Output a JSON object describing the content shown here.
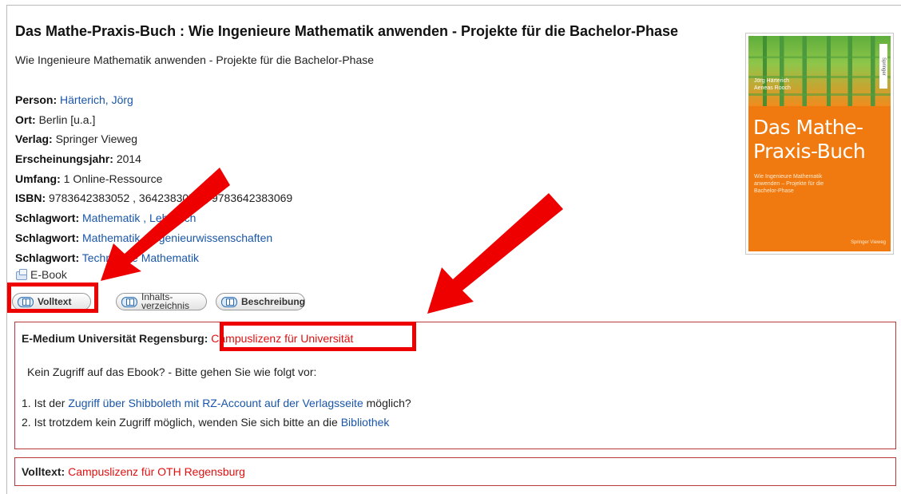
{
  "record": {
    "title": "Das Mathe-Praxis-Buch :  Wie Ingenieure Mathematik anwenden - Projekte für die Bachelor-Phase",
    "subtitle": "Wie Ingenieure Mathematik anwenden - Projekte für die Bachelor-Phase"
  },
  "meta": {
    "person_label": "Person:",
    "person_value": "Härterich, Jörg",
    "ort_label": "Ort:",
    "ort_value": "Berlin [u.a.]",
    "verlag_label": "Verlag:",
    "verlag_value": "Springer Vieweg",
    "jahr_label": "Erscheinungsjahr:",
    "jahr_value": "2014",
    "umfang_label": "Umfang:",
    "umfang_value": "1 Online-Ressource",
    "isbn_label": "ISBN:",
    "isbn_value": "9783642383052 , 364238305X , 9783642383069",
    "schlagwort_label": "Schlagwort:",
    "schlagwort_1": "Mathematik , Lehrbuch",
    "schlagwort_2": "Mathematik , Ingenieurwissenschaften",
    "schlagwort_3": "Technische Mathematik"
  },
  "media_type": "E-Book",
  "buttons": {
    "volltext": "Volltext",
    "inhalt_line1": "Inhalts-",
    "inhalt_line2": "verzeichnis",
    "beschreibung": "Beschreibung"
  },
  "access_panel": {
    "label": "E-Medium Universität Regensburg:",
    "license": "Campuslizenz für Universität",
    "notice": "Kein Zugriff auf das Ebook? - Bitte gehen Sie wie folgt vor:",
    "step1_prefix": "1. Ist der ",
    "step1_link": "Zugriff über Shibboleth mit RZ-Account auf der Verlagsseite",
    "step1_suffix": " möglich?",
    "step2_prefix": "2. Ist trotzdem kein Zugriff möglich, wenden Sie sich bitte an die ",
    "step2_link": "Bibliothek"
  },
  "fulltext_panel": {
    "label": "Volltext:",
    "license": "Campuslizenz für OTH Regensburg"
  },
  "cover": {
    "authors_line1": "Jörg Härterich",
    "authors_line2": "Aeneas Rooch",
    "title_line1": "Das Mathe-",
    "title_line2": "Praxis-Buch",
    "subtitle": "Wie Ingenieure Mathematik anwenden – Projekte für die Bachelor-Phase",
    "publisher": "Springer Vieweg",
    "spine": "Springer"
  },
  "colors": {
    "link_blue": "#1a56a8",
    "license_red": "#e01010",
    "annotation_red": "#ee0000",
    "cover_orange": "#f07a10"
  }
}
